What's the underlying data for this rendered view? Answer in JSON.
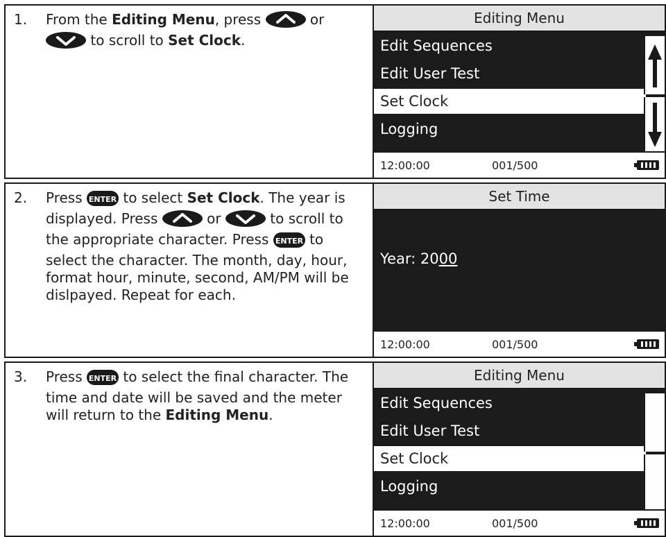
{
  "steps": [
    {
      "number": "1.",
      "text": {
        "a": "From the ",
        "b": "Editing Menu",
        "c": ", press ",
        "d": " or",
        "e": " to scroll to ",
        "f": "Set Clock",
        "g": "."
      },
      "screen": {
        "title": "Editing Menu",
        "items": [
          "Edit Sequences",
          "Edit User Test",
          "Set Clock",
          "Logging"
        ],
        "selected_index": 2,
        "time": "12:00:00",
        "count": "001/500"
      }
    },
    {
      "number": "2.",
      "text": {
        "a": "Press ",
        "b": " to select ",
        "c": "Set Clock",
        "d": ". The year is displayed. Press ",
        "e": " or ",
        "f": " to scroll to the appropriate character. Press ",
        "g": " to select the character. The month, day, hour, format hour, minute, second, AM/PM will be dislpayed. Repeat for each."
      },
      "screen": {
        "title": "Set Time",
        "year_label": "Year: 20",
        "year_digits": "00",
        "time": "12:00:00",
        "count": "001/500"
      }
    },
    {
      "number": "3.",
      "text": {
        "a": "Press ",
        "b": " to select the final character. The time and date will be saved and the meter will return to the ",
        "c": "Editing Menu",
        "d": "."
      },
      "screen": {
        "title": "Editing Menu",
        "items": [
          "Edit Sequences",
          "Edit User Test",
          "Set Clock",
          "Logging"
        ],
        "selected_index": 2,
        "time": "12:00:00",
        "count": "001/500"
      }
    }
  ],
  "icons": {
    "up": "up-arrow-button-icon",
    "down": "down-arrow-button-icon",
    "enter": "enter-button-icon",
    "enter_label": "ENTER",
    "battery": "battery-icon"
  },
  "colors": {
    "screen_bg": "#1b1b1b",
    "title_bg": "#e3e3e3",
    "selected_bg": "#ffffff"
  }
}
